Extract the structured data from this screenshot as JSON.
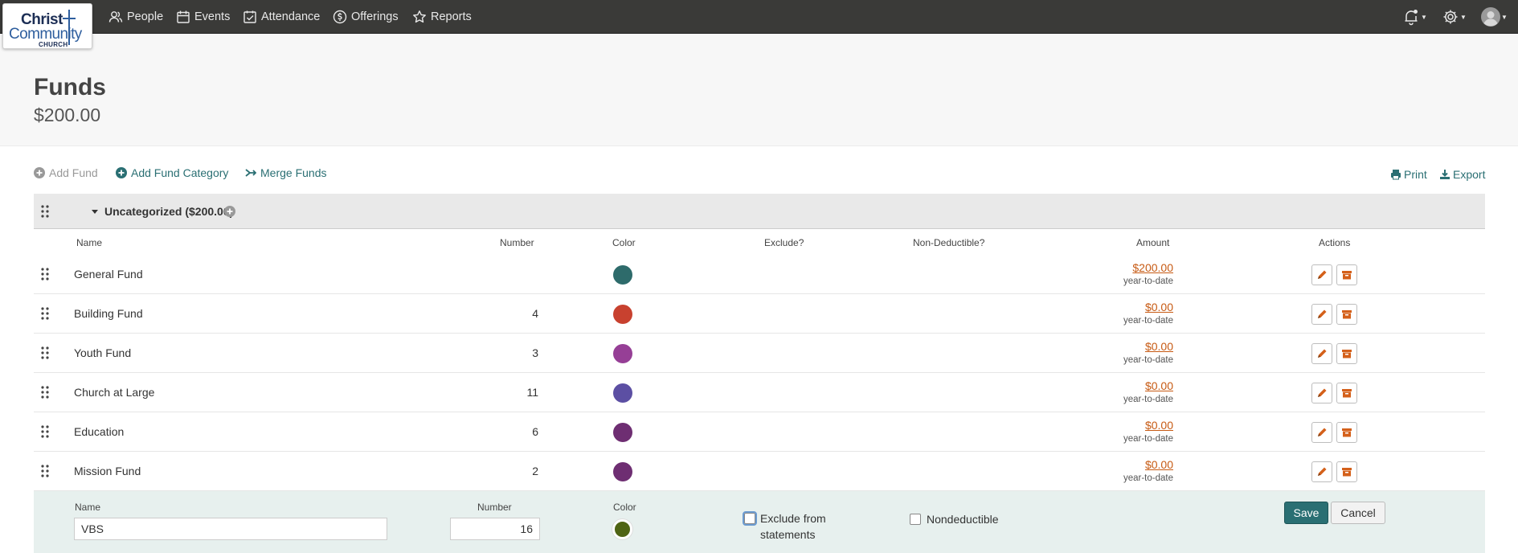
{
  "brand": {
    "logo_line1": "Christ",
    "logo_line2": "Community",
    "logo_line3": "CHURCH"
  },
  "nav": [
    {
      "label": "People",
      "icon": "people-icon"
    },
    {
      "label": "Events",
      "icon": "calendar-icon"
    },
    {
      "label": "Attendance",
      "icon": "checkbox-icon"
    },
    {
      "label": "Offerings",
      "icon": "offering-icon"
    },
    {
      "label": "Reports",
      "icon": "star-icon"
    }
  ],
  "page": {
    "title": "Funds",
    "total": "$200.00"
  },
  "toolbar": {
    "add_fund": "Add Fund",
    "add_fund_category": "Add Fund Category",
    "merge_funds": "Merge Funds",
    "print": "Print",
    "export": "Export"
  },
  "category": {
    "title": "Uncategorized ($200.00)"
  },
  "columns": {
    "name": "Name",
    "number": "Number",
    "color": "Color",
    "exclude": "Exclude?",
    "nondeductible": "Non-Deductible?",
    "amount": "Amount",
    "actions": "Actions"
  },
  "funds": [
    {
      "name": "General Fund",
      "number": "",
      "color": "#2e6b6b",
      "amount": "$200.00",
      "period": "year-to-date"
    },
    {
      "name": "Building Fund",
      "number": "4",
      "color": "#c8412f",
      "amount": "$0.00",
      "period": "year-to-date"
    },
    {
      "name": "Youth Fund",
      "number": "3",
      "color": "#963f96",
      "amount": "$0.00",
      "period": "year-to-date"
    },
    {
      "name": "Church at Large",
      "number": "11",
      "color": "#5c4fa3",
      "amount": "$0.00",
      "period": "year-to-date"
    },
    {
      "name": "Education",
      "number": "6",
      "color": "#6e2e72",
      "amount": "$0.00",
      "period": "year-to-date"
    },
    {
      "name": "Mission Fund",
      "number": "2",
      "color": "#6e2e72",
      "amount": "$0.00",
      "period": "year-to-date"
    }
  ],
  "edit_row": {
    "name_label": "Name",
    "name_value": "VBS",
    "number_label": "Number",
    "number_value": "16",
    "color_label": "Color",
    "color_value": "#4f6414",
    "exclude_label": "Exclude from statements",
    "nondeductible_label": "Nondeductible",
    "save_label": "Save",
    "cancel_label": "Cancel"
  }
}
